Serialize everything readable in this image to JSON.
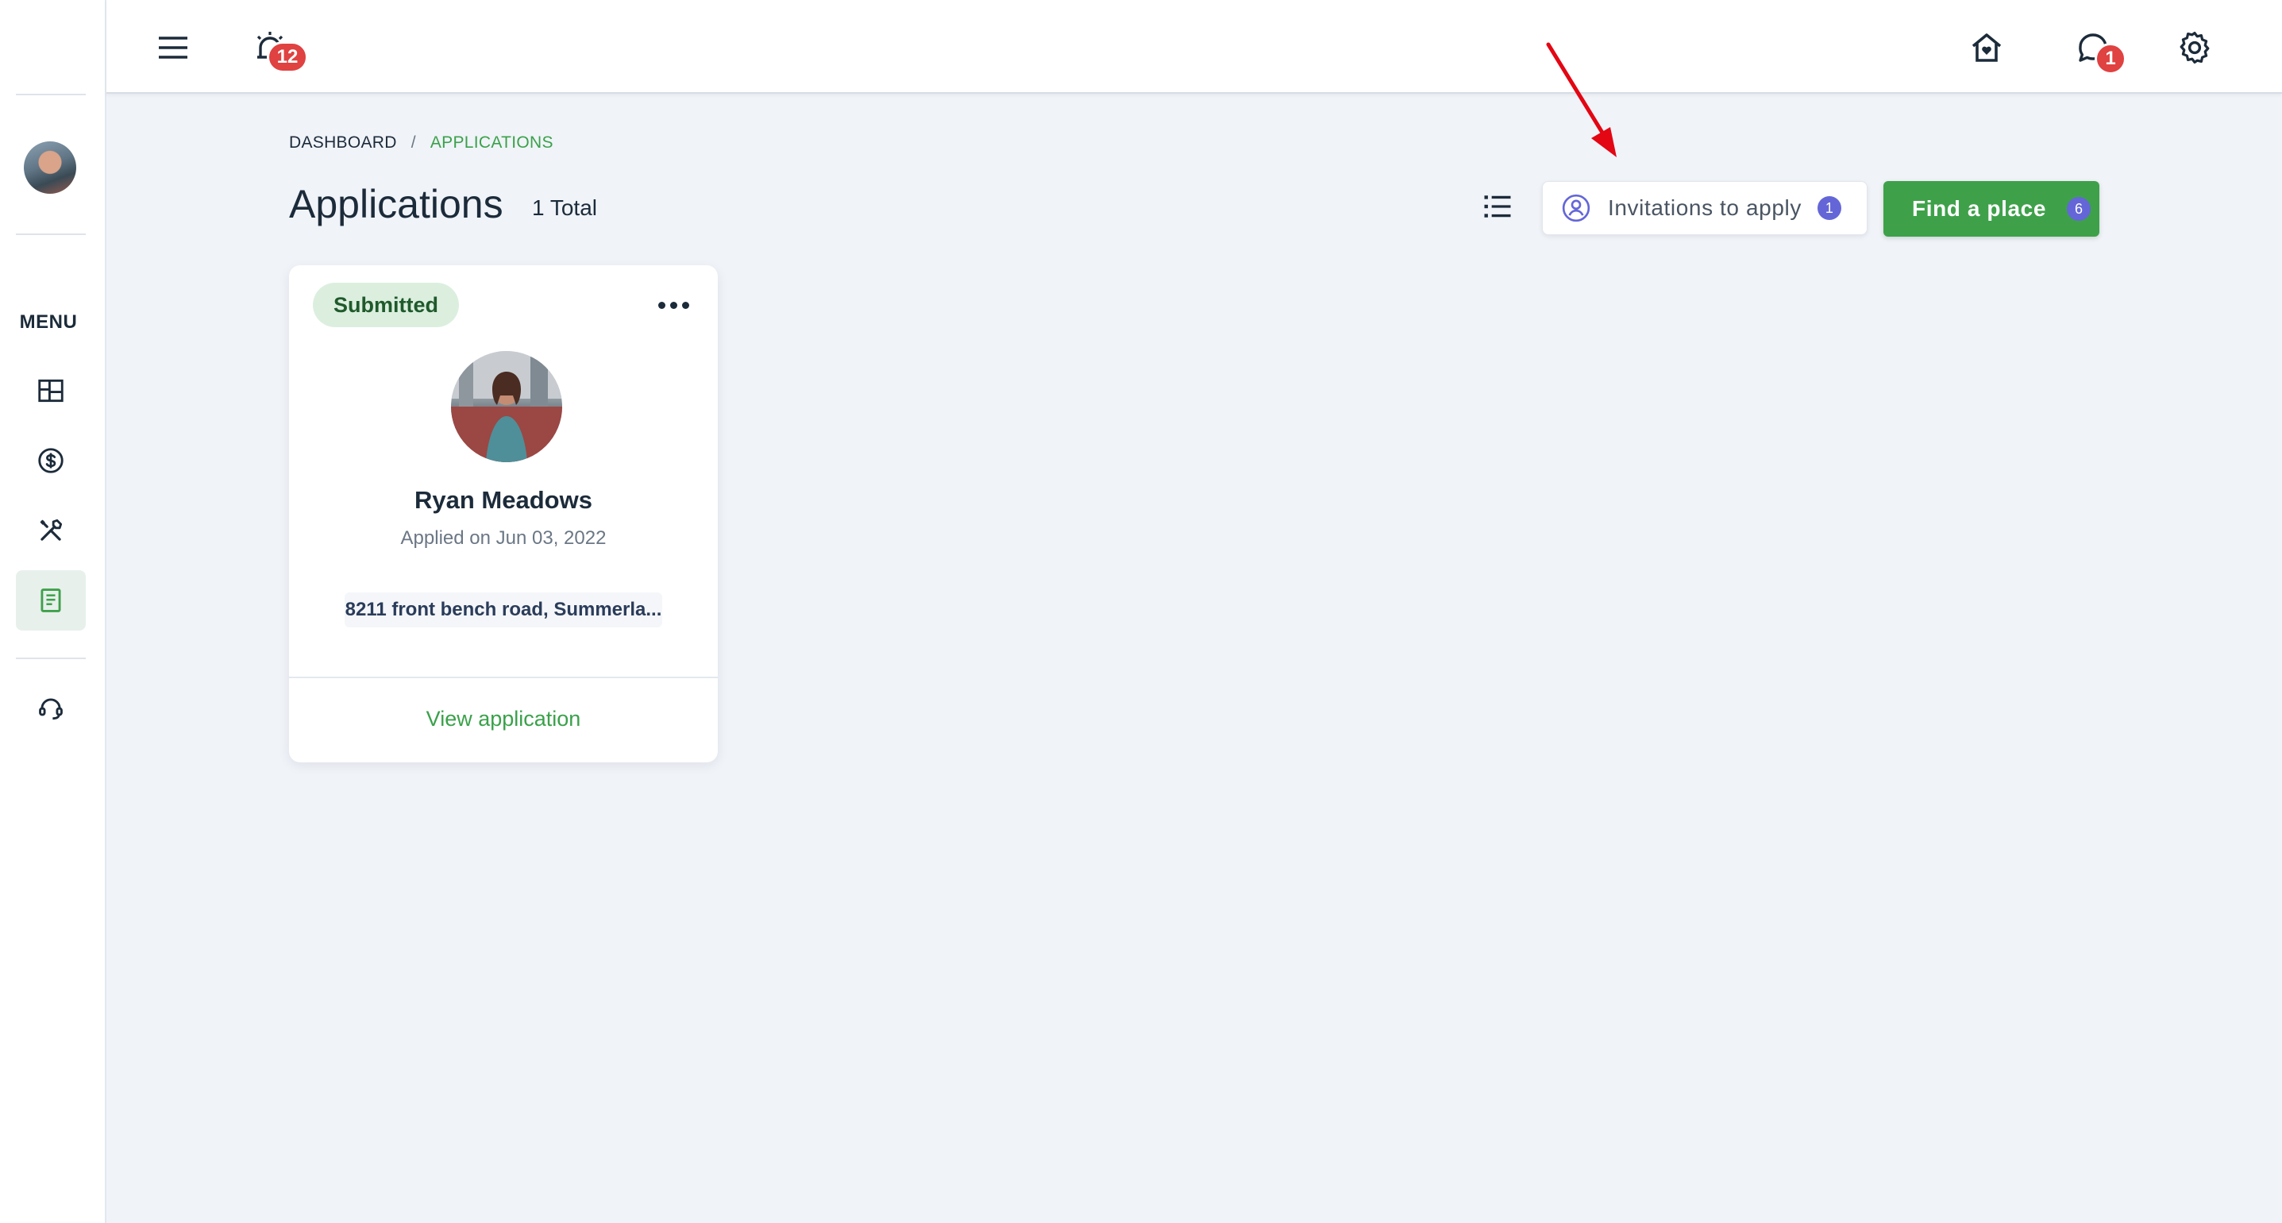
{
  "topbar": {
    "notification_count": "12",
    "messages_count": "1"
  },
  "sidebar": {
    "menu_label": "MENU",
    "items": [
      {
        "name": "dashboard"
      },
      {
        "name": "payments"
      },
      {
        "name": "maintenance"
      },
      {
        "name": "applications",
        "active": true
      },
      {
        "name": "support"
      }
    ]
  },
  "breadcrumb": {
    "parent": "DASHBOARD",
    "separator": "/",
    "current": "APPLICATIONS"
  },
  "header": {
    "title": "Applications",
    "total": "1 Total",
    "invitations_label": "Invitations to apply",
    "invitations_count": "1",
    "find_place_label": "Find a place",
    "find_place_count": "6"
  },
  "card": {
    "status": "Submitted",
    "name": "Ryan Meadows",
    "applied_on": "Applied on Jun 03, 2022",
    "address": "8211 front bench road, Summerla...",
    "view_link": "View application"
  },
  "colors": {
    "accent_green": "#3ea14a",
    "badge_red": "#e04141",
    "badge_purple": "#6466d8",
    "annotation_arrow": "#e30613"
  }
}
